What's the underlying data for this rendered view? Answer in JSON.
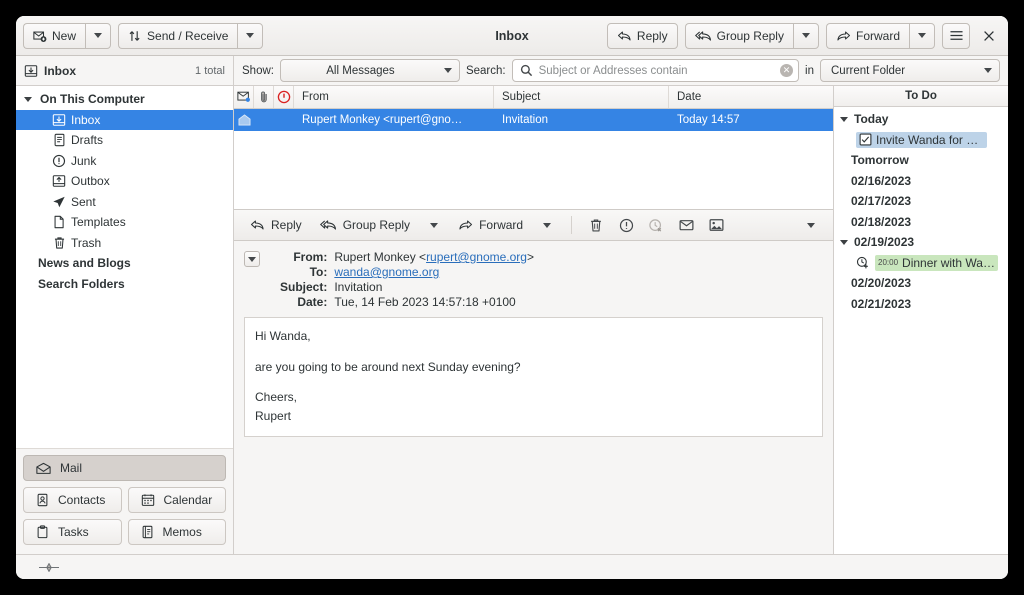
{
  "window": {
    "title": "Inbox",
    "close_label": "×"
  },
  "toolbar": {
    "new_label": "New",
    "send_receive_label": "Send / Receive",
    "reply_label": "Reply",
    "group_reply_label": "Group Reply",
    "forward_label": "Forward",
    "menu_label": "",
    "dropdown_label": ""
  },
  "searchbar": {
    "folder_name": "Inbox",
    "total_label": "1 total",
    "show_label": "Show:",
    "show_value": "All Messages",
    "search_label": "Search:",
    "search_value": "",
    "search_placeholder": "Subject or Addresses contain",
    "in_label": "in",
    "scope_value": "Current Folder"
  },
  "sidebar": {
    "items": [
      {
        "label": "On This Computer",
        "level": "top",
        "icon": "none",
        "selected": false,
        "expander": true
      },
      {
        "label": "Inbox",
        "level": "child",
        "icon": "inbox-icon",
        "selected": true,
        "expander": false
      },
      {
        "label": "Drafts",
        "level": "child",
        "icon": "drafts-icon",
        "selected": false,
        "expander": false
      },
      {
        "label": "Junk",
        "level": "child",
        "icon": "junk-icon",
        "selected": false,
        "expander": false
      },
      {
        "label": "Outbox",
        "level": "child",
        "icon": "outbox-icon",
        "selected": false,
        "expander": false
      },
      {
        "label": "Sent",
        "level": "child",
        "icon": "sent-icon",
        "selected": false,
        "expander": false
      },
      {
        "label": "Templates",
        "level": "child",
        "icon": "templates-icon",
        "selected": false,
        "expander": false
      },
      {
        "label": "Trash",
        "level": "child",
        "icon": "trash-icon",
        "selected": false,
        "expander": false
      },
      {
        "label": "News and Blogs",
        "level": "root",
        "icon": "none",
        "selected": false,
        "expander": false
      },
      {
        "label": "Search Folders",
        "level": "root",
        "icon": "none",
        "selected": false,
        "expander": false
      }
    ],
    "switcher": {
      "mail": "Mail",
      "contacts": "Contacts",
      "calendar": "Calendar",
      "tasks": "Tasks",
      "memos": "Memos"
    }
  },
  "message_list": {
    "columns": [
      "From",
      "Subject",
      "Date"
    ],
    "rows": [
      {
        "from": "Rupert Monkey <rupert@gno…",
        "subject": "Invitation",
        "date": "Today 14:57",
        "selected": true
      }
    ]
  },
  "preview_toolbar": {
    "reply_label": "Reply",
    "group_reply_label": "Group Reply",
    "forward_label": "Forward"
  },
  "message": {
    "from_label": "From:",
    "from_name": "Rupert Monkey <",
    "from_email": "rupert@gnome.org",
    "from_suffix": ">",
    "to_label": "To:",
    "to_value": "wanda@gnome.org",
    "subject_label": "Subject:",
    "subject_value": "Invitation",
    "date_label": "Date:",
    "date_value": "Tue, 14 Feb 2023 14:57:18 +0100",
    "body": [
      "Hi Wanda,",
      "are you going to be around next Sunday evening?",
      "Cheers,\nRupert"
    ],
    "body_line1": "Hi Wanda,",
    "body_line2": "are you going to be around next Sunday evening?",
    "body_line3": "Cheers,",
    "body_line4": "Rupert"
  },
  "todo": {
    "title": "To Do",
    "entries": [
      {
        "label": "Today",
        "type": "group",
        "expander": true
      },
      {
        "label": "Invite Wanda for din…",
        "type": "task",
        "time": "",
        "highlight": "#bdd3e8"
      },
      {
        "label": "Tomorrow",
        "type": "group",
        "expander": false
      },
      {
        "label": "02/16/2023",
        "type": "group",
        "expander": false
      },
      {
        "label": "02/17/2023",
        "type": "group",
        "expander": false
      },
      {
        "label": "02/18/2023",
        "type": "group",
        "expander": false
      },
      {
        "label": "02/19/2023",
        "type": "group",
        "expander": true
      },
      {
        "label": "Dinner with Wa…",
        "type": "appointment",
        "time": "20:00",
        "highlight": "#c9e6bd"
      },
      {
        "label": "02/20/2023",
        "type": "group",
        "expander": false
      },
      {
        "label": "02/21/2023",
        "type": "group",
        "expander": false
      }
    ]
  },
  "colors": {
    "selection_blue": "#3584e4",
    "task_highlight": "#bdd3e8",
    "appointment_highlight": "#c9e6bd",
    "link": "#2a6ebb"
  }
}
